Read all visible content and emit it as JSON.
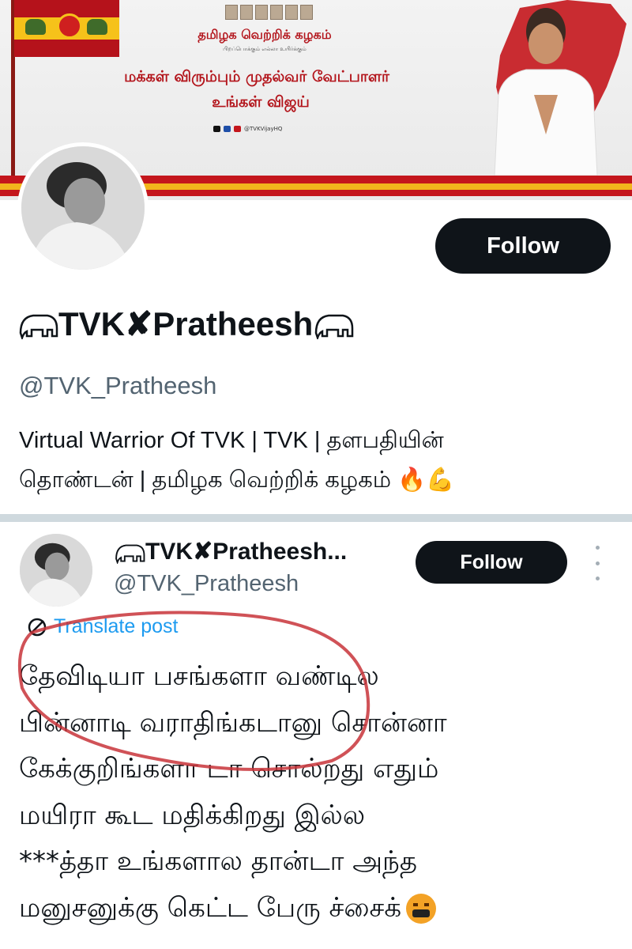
{
  "banner": {
    "party_name": "தமிழக வெற்றிக் கழகம்",
    "tagline": "பிறப்பொக்கும் எல்லா உயிர்க்கும்",
    "headline_line1": "மக்கள் விரும்பும் முதல்வர் வேட்பாளர்",
    "headline_line2": "உங்கள் விஜய்",
    "social_handle": "@TVKVijayHQ",
    "colors": {
      "red": "#c4161c",
      "yellow": "#f2b51c"
    }
  },
  "profile": {
    "display_name_text": "TVK",
    "display_name_cross": "✘",
    "display_name_tail": "Pratheesh",
    "handle": "@TVK_Pratheesh",
    "follow_label": "Follow",
    "bio_line1": "Virtual Warrior Of TVK | TVK | தளபதியின்",
    "bio_line2": "தொண்டன் | தமிழக வெற்றிக் கழகம் 🔥💪",
    "icons": [
      "elephant-icon",
      "avatar"
    ]
  },
  "post": {
    "display_name_text": "TVK",
    "display_name_cross": "✘",
    "display_name_tail": "Pratheesh...",
    "handle": "@TVK_Pratheesh",
    "follow_label": "Follow",
    "translate_label": "Translate post",
    "lines": [
      "தேவிடியா பசங்களா வண்டில",
      "பின்னாடி வராதிங்கடானு சொன்னா",
      "கேக்குறிங்களா டா சொல்றது எதும்",
      "மயிரா கூட மதிக்கிறது இல்ல",
      "***த்தா உங்களால தான்டா அந்த",
      "மனுசனுக்கு கெட்ட பேரு ச்சைக்"
    ],
    "annotation_color": "#c8343a",
    "link_color": "#1d9bf0"
  }
}
